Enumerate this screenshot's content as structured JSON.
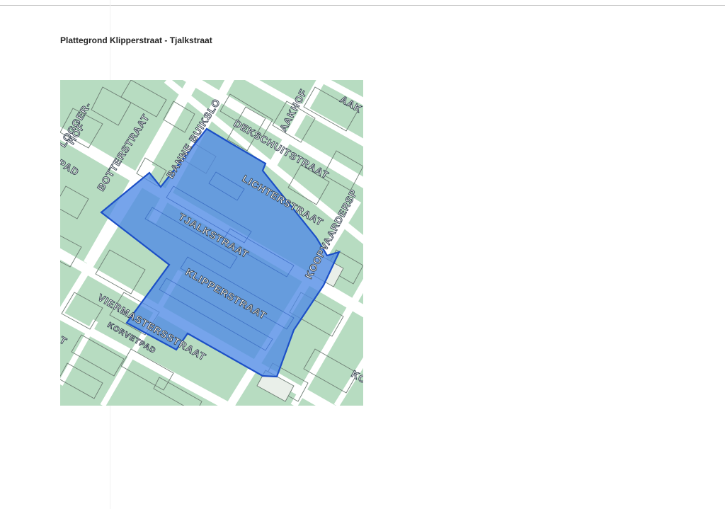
{
  "page": {
    "title": "Plattegrond Klipperstraat - Tjalkstraat"
  },
  "map": {
    "colors": {
      "block_green": "#b7dcc1",
      "street_white": "#ffffff",
      "outline_grey": "#6d7d73",
      "highlight_fill": "#4f8ae6",
      "highlight_stroke": "#1c4fc6"
    },
    "street_labels": {
      "logger": "LOGGER-",
      "hof": "HOF",
      "pad": "PAD",
      "botterstraat": "BOTTERSTRAAT",
      "bannebuikslo": "BANNE BUIKSLO",
      "dekschuitstraat": "DEKSCHUITSTRAAT",
      "aakhof": "AAKHOF",
      "aak": "AAK",
      "lichterstraat": "LICHTERSTRAAT",
      "tjalkstraat": "TJALKSTRAAT",
      "klipperstraat": "KLIPPERSTRAAT",
      "koopvaarders": "KOOPVAARDERSP",
      "viermastersstraat": "VIERMASTERSSTRAAT",
      "korvetpad": "KORVETPAD",
      "edge_t": "T",
      "ko": "KO"
    }
  }
}
